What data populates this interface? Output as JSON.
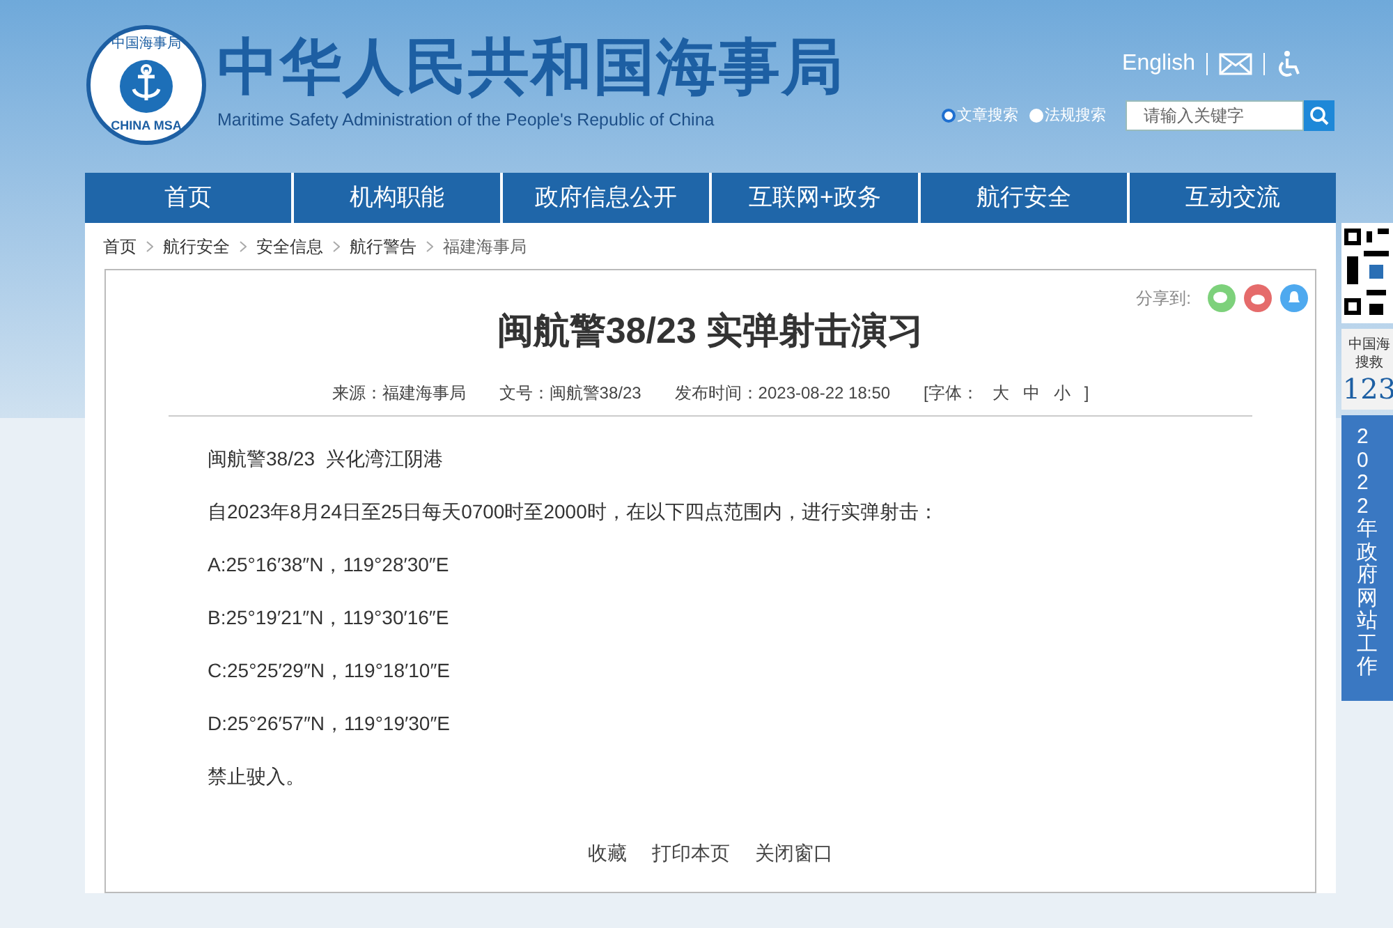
{
  "header": {
    "logo_top": "中国海事局",
    "logo_bottom": "CHINA MSA",
    "title": "中华人民共和国海事局",
    "subtitle": "Maritime Safety Administration of the People's Republic of China",
    "english_link": "English",
    "search_modes": [
      {
        "label": "文章搜索",
        "selected": true
      },
      {
        "label": "法规搜索",
        "selected": false
      }
    ],
    "search": {
      "placeholder": "请输入关键字"
    }
  },
  "nav": [
    "首页",
    "机构职能",
    "政府信息公开",
    "互联网+政务",
    "航行安全",
    "互动交流"
  ],
  "breadcrumb": [
    "首页",
    "航行安全",
    "安全信息",
    "航行警告",
    "福建海事局"
  ],
  "article": {
    "share_label": "分享到:",
    "title": "闽航警38/23 实弹射击演习",
    "meta": [
      {
        "label": "来源：",
        "value": "福建海事局"
      },
      {
        "label": "文号：",
        "value": "闽航警38/23"
      },
      {
        "label": "发布时间：",
        "value": "2023-08-22 18:50"
      }
    ],
    "font_label": "[字体：",
    "font_sizes": [
      "大",
      "中",
      "小"
    ],
    "font_close": "]",
    "paragraphs": [
      "闽航警38/23  兴化湾江阴港",
      "自2023年8月24日至25日每天0700时至2000时，在以下四点范围内，进行实弹射击：",
      "A:25°16′38″N，119°28′30″E",
      "B:25°19′21″N，119°30′16″E",
      "C:25°25′29″N，119°18′10″E",
      "D:25°26′57″N，119°19′30″E",
      "禁止驶入。"
    ],
    "actions": [
      "收藏",
      "打印本页",
      "关闭窗口"
    ]
  },
  "side": {
    "rescue_line1": "中国海",
    "rescue_line2": "搜救",
    "rescue_number": "123",
    "banner": "2022年政府网站工作"
  }
}
